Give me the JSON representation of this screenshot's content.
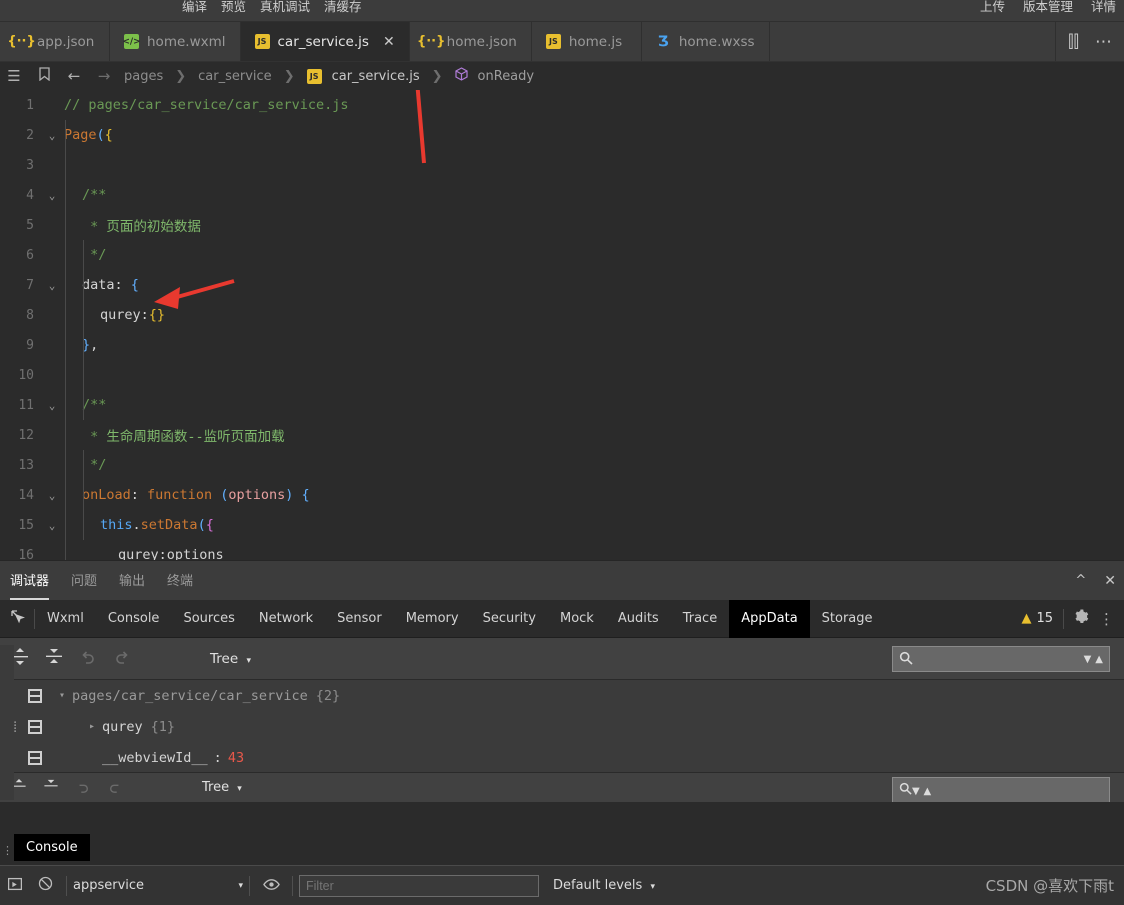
{
  "topbar": {
    "menu_items": [
      "编译",
      "预览",
      "真机调试",
      "清缓存"
    ],
    "right_items": [
      "上传",
      "版本管理",
      "详情"
    ]
  },
  "tabs": [
    {
      "label": "app.json",
      "icon": "json-file-icon",
      "type": "appjson",
      "active": false,
      "closable": false
    },
    {
      "label": "home.wxml",
      "icon": "wxml-file-icon",
      "type": "wxml",
      "active": false,
      "closable": false
    },
    {
      "label": "car_service.js",
      "icon": "js-file-icon",
      "type": "js",
      "active": true,
      "closable": true
    },
    {
      "label": "home.json",
      "icon": "json-file-icon",
      "type": "json",
      "active": false,
      "closable": false
    },
    {
      "label": "home.js",
      "icon": "js-file-icon",
      "type": "js",
      "active": false,
      "closable": false
    },
    {
      "label": "home.wxss",
      "icon": "wxss-file-icon",
      "type": "wxss",
      "active": false,
      "closable": false
    }
  ],
  "tabbar_actions": {
    "split_editor": "⫿⫿",
    "more": "⋯"
  },
  "breadcrumb": {
    "menu_icon": "☰",
    "bookmark_icon": "bookmark",
    "back_icon": "←",
    "forward_icon": "→",
    "parts": [
      "pages",
      "car_service",
      "car_service.js",
      "onReady"
    ],
    "separator": "❯"
  },
  "code": {
    "lines": [
      {
        "n": "1",
        "fold": "",
        "indent": 0,
        "tokens": [
          {
            "t": "// pages/car_service/car_service.js",
            "c": "c-comment"
          }
        ]
      },
      {
        "n": "2",
        "fold": "v",
        "indent": 0,
        "tokens": [
          {
            "t": "Page",
            "c": "c-key"
          },
          {
            "t": "(",
            "c": "c-paren"
          },
          {
            "t": "{",
            "c": "c-brace-y"
          }
        ]
      },
      {
        "n": "3",
        "fold": "",
        "indent": 0,
        "tokens": []
      },
      {
        "n": "4",
        "fold": "v",
        "indent": 1,
        "tokens": [
          {
            "t": "/**",
            "c": "c-comment"
          }
        ]
      },
      {
        "n": "5",
        "fold": "",
        "indent": 1,
        "tokens": [
          {
            "t": " * ",
            "c": "c-comment"
          },
          {
            "t": "页面的初始数据",
            "c": "c-comment-cn"
          }
        ]
      },
      {
        "n": "6",
        "fold": "",
        "indent": 1,
        "tokens": [
          {
            "t": " */",
            "c": "c-comment"
          }
        ]
      },
      {
        "n": "7",
        "fold": "v",
        "indent": 1,
        "tokens": [
          {
            "t": "data",
            "c": "c-ident"
          },
          {
            "t": ": ",
            "c": "c-ident"
          },
          {
            "t": "{",
            "c": "c-brace"
          }
        ]
      },
      {
        "n": "8",
        "fold": "",
        "indent": 2,
        "tokens": [
          {
            "t": "qurey",
            "c": "c-ident"
          },
          {
            "t": ":",
            "c": "c-ident"
          },
          {
            "t": "{}",
            "c": "c-brace-y"
          }
        ]
      },
      {
        "n": "9",
        "fold": "",
        "indent": 1,
        "tokens": [
          {
            "t": "}",
            "c": "c-brace"
          },
          {
            "t": ",",
            "c": "c-ident"
          }
        ]
      },
      {
        "n": "10",
        "fold": "",
        "indent": 0,
        "tokens": []
      },
      {
        "n": "11",
        "fold": "v",
        "indent": 1,
        "tokens": [
          {
            "t": "/**",
            "c": "c-comment"
          }
        ]
      },
      {
        "n": "12",
        "fold": "",
        "indent": 1,
        "tokens": [
          {
            "t": " * ",
            "c": "c-comment"
          },
          {
            "t": "生命周期函数--监听页面加载",
            "c": "c-comment-cn"
          }
        ]
      },
      {
        "n": "13",
        "fold": "",
        "indent": 1,
        "tokens": [
          {
            "t": " */",
            "c": "c-comment"
          }
        ]
      },
      {
        "n": "14",
        "fold": "v",
        "indent": 1,
        "tokens": [
          {
            "t": "onLoad",
            "c": "c-key"
          },
          {
            "t": ": ",
            "c": "c-ident"
          },
          {
            "t": "function",
            "c": "c-key"
          },
          {
            "t": " ",
            "c": "c-ident"
          },
          {
            "t": "(",
            "c": "c-paren"
          },
          {
            "t": "options",
            "c": "c-param"
          },
          {
            "t": ")",
            "c": "c-paren"
          },
          {
            "t": " ",
            "c": "c-ident"
          },
          {
            "t": "{",
            "c": "c-brace"
          }
        ]
      },
      {
        "n": "15",
        "fold": "v",
        "indent": 2,
        "tokens": [
          {
            "t": "this",
            "c": "c-this"
          },
          {
            "t": ".",
            "c": "c-ident"
          },
          {
            "t": "setData",
            "c": "c-fn"
          },
          {
            "t": "(",
            "c": "c-paren"
          },
          {
            "t": "{",
            "c": "c-brace-p"
          }
        ]
      },
      {
        "n": "16",
        "fold": "",
        "indent": 3,
        "tokens": [
          {
            "t": "qurey",
            "c": "c-ident"
          },
          {
            "t": ":",
            "c": "c-ident"
          },
          {
            "t": "options",
            "c": "c-ident"
          }
        ]
      }
    ]
  },
  "debugger": {
    "tabs": [
      "调试器",
      "问题",
      "输出",
      "终端"
    ],
    "active_tab": "调试器",
    "collapse_icon": "^",
    "close_icon": "✕"
  },
  "devtools": {
    "inspect_icon": "inspect-element-icon",
    "tabs": [
      "Wxml",
      "Console",
      "Sources",
      "Network",
      "Sensor",
      "Memory",
      "Security",
      "Mock",
      "Audits",
      "Trace",
      "AppData",
      "Storage"
    ],
    "active_tab": "AppData",
    "warning_count": "15",
    "warning_icon": "warning-triangle-icon",
    "settings_icon": "gear-icon",
    "more_icon": "kebab-menu-icon"
  },
  "appdata": {
    "expand_all_icon": "expand-all-icon",
    "collapse_all_icon": "collapse-all-icon",
    "undo_icon": "undo-icon",
    "redo_icon": "redo-icon",
    "view_mode": "Tree",
    "view_mode_caret": "▾",
    "search_placeholder": "",
    "search_value": "",
    "search_icon": "search-icon",
    "next_match_icon": "▼",
    "prev_match_icon": "▲",
    "tree": [
      {
        "caret": "▾",
        "key": "pages/car_service/car_service",
        "count": "{2}",
        "value": "",
        "indent": 0,
        "key_class": "tree-path",
        "has_grip": false
      },
      {
        "caret": "▸",
        "key": "qurey",
        "count": "{1}",
        "value": "",
        "indent": 1,
        "key_class": "tree-key",
        "has_grip": true
      },
      {
        "caret": "",
        "key": "__webviewId__",
        "count": "",
        "value": "43",
        "indent": 1,
        "key_class": "tree-key",
        "has_grip": false
      }
    ]
  },
  "lower_panel": {
    "view_mode": "Tree",
    "view_mode_caret": "▾",
    "search_icon": "search-icon"
  },
  "console_chip": {
    "label": "Console"
  },
  "console_bar": {
    "sidebar_toggle_icon": "sidebar-toggle-icon",
    "clear_icon": "clear-console-icon",
    "context_value": "appservice",
    "context_caret": "▾",
    "eye_icon": "live-expression-icon",
    "filter_placeholder": "Filter",
    "filter_value": "",
    "levels_label": "Default levels",
    "levels_caret": "▾",
    "watermark": "CSDN @喜欢下雨t"
  },
  "colors": {
    "editor_bg": "#2b2b2b",
    "chrome_bg": "#3c3c3c",
    "panel_bg": "#414141",
    "tree_bg": "#3b3b3b",
    "accent_active": "#000000",
    "warning": "#e8bf2f",
    "annotation_arrow": "#e8392f",
    "number_value": "#e8584a"
  }
}
